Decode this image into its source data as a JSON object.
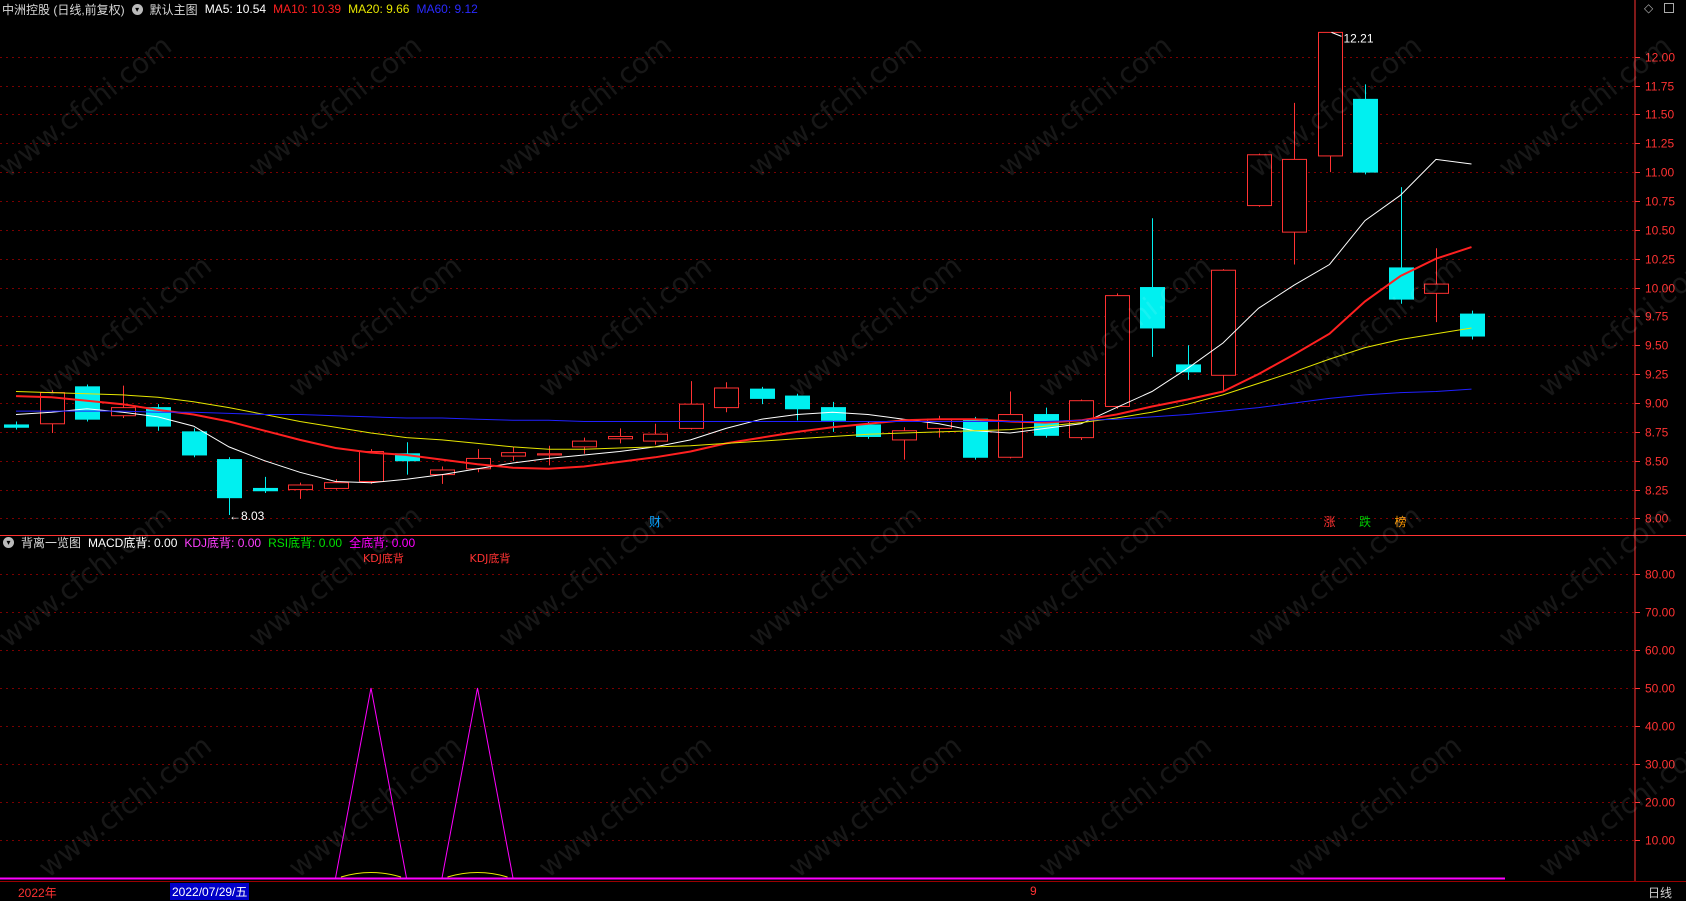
{
  "main_header": {
    "stock": "中洲控股 (日线,前复权)",
    "panel_name": "默认主图",
    "ma5": "MA5: 10.54",
    "ma10": "MA10: 10.39",
    "ma20": "MA20: 9.66",
    "ma60": "MA60: 9.12"
  },
  "sub_header": {
    "panel_name": "背离一览图",
    "macd": "MACD底背: 0.00",
    "kdj": "KDJ底背: 0.00",
    "rsi": "RSI底背: 0.00",
    "all": "全底背: 0.00"
  },
  "colors": {
    "up": "#ff3232",
    "down": "#00f0f0",
    "ma5": "#ffffff",
    "ma10": "#ff2020",
    "ma20": "#e6e600",
    "ma60": "#2020ff",
    "grid": "#7a0000",
    "axis": "#ff3232",
    "sub_line": "#ff00ff"
  },
  "watermark": "www.cfchi.com",
  "chart_data": [
    {
      "type": "candlestick",
      "title": "默认主图",
      "ylim": [
        7.9,
        12.3
      ],
      "y_ticks": [
        "12.00",
        "11.75",
        "11.50",
        "11.25",
        "11.00",
        "10.75",
        "10.50",
        "10.25",
        "10.00",
        "9.75",
        "9.50",
        "9.25",
        "9.00",
        "8.75",
        "8.50",
        "8.25",
        "8.00"
      ],
      "candles": [
        {
          "o": 8.81,
          "c": 8.79,
          "h": 8.84,
          "l": 8.77
        },
        {
          "o": 8.82,
          "c": 9.09,
          "h": 9.11,
          "l": 8.74
        },
        {
          "o": 9.14,
          "c": 8.86,
          "h": 9.16,
          "l": 8.84
        },
        {
          "o": 8.89,
          "c": 8.96,
          "h": 9.15,
          "l": 8.87
        },
        {
          "o": 8.96,
          "c": 8.8,
          "h": 8.99,
          "l": 8.76
        },
        {
          "o": 8.75,
          "c": 8.55,
          "h": 8.78,
          "l": 8.53
        },
        {
          "o": 8.51,
          "c": 8.18,
          "h": 8.53,
          "l": 8.03
        },
        {
          "o": 8.26,
          "c": 8.24,
          "h": 8.36,
          "l": 8.22
        },
        {
          "o": 8.25,
          "c": 8.29,
          "h": 8.31,
          "l": 8.17
        },
        {
          "o": 8.26,
          "c": 8.31,
          "h": 8.34,
          "l": 8.25
        },
        {
          "o": 8.32,
          "c": 8.58,
          "h": 8.6,
          "l": 8.3
        },
        {
          "o": 8.56,
          "c": 8.5,
          "h": 8.66,
          "l": 8.38
        },
        {
          "o": 8.38,
          "c": 8.42,
          "h": 8.45,
          "l": 8.3
        },
        {
          "o": 8.43,
          "c": 8.52,
          "h": 8.6,
          "l": 8.4
        },
        {
          "o": 8.54,
          "c": 8.57,
          "h": 8.62,
          "l": 8.5
        },
        {
          "o": 8.55,
          "c": 8.56,
          "h": 8.63,
          "l": 8.46
        },
        {
          "o": 8.62,
          "c": 8.67,
          "h": 8.7,
          "l": 8.56
        },
        {
          "o": 8.69,
          "c": 8.71,
          "h": 8.78,
          "l": 8.65
        },
        {
          "o": 8.67,
          "c": 8.73,
          "h": 8.82,
          "l": 8.64
        },
        {
          "o": 8.78,
          "c": 8.99,
          "h": 9.19,
          "l": 8.77
        },
        {
          "o": 8.96,
          "c": 9.13,
          "h": 9.18,
          "l": 8.92
        },
        {
          "o": 9.12,
          "c": 9.04,
          "h": 9.14,
          "l": 8.99
        },
        {
          "o": 9.06,
          "c": 8.95,
          "h": 9.08,
          "l": 8.85
        },
        {
          "o": 8.96,
          "c": 8.85,
          "h": 9.01,
          "l": 8.75
        },
        {
          "o": 8.81,
          "c": 8.71,
          "h": 8.84,
          "l": 8.69
        },
        {
          "o": 8.68,
          "c": 8.76,
          "h": 8.79,
          "l": 8.51
        },
        {
          "o": 8.78,
          "c": 8.86,
          "h": 8.89,
          "l": 8.7
        },
        {
          "o": 8.86,
          "c": 8.53,
          "h": 8.88,
          "l": 8.51
        },
        {
          "o": 8.53,
          "c": 8.9,
          "h": 9.1,
          "l": 8.52
        },
        {
          "o": 8.9,
          "c": 8.72,
          "h": 8.96,
          "l": 8.7
        },
        {
          "o": 8.7,
          "c": 9.02,
          "h": 9.03,
          "l": 8.68
        },
        {
          "o": 8.97,
          "c": 9.93,
          "h": 9.95,
          "l": 8.95
        },
        {
          "o": 10.0,
          "c": 9.65,
          "h": 10.6,
          "l": 9.4
        },
        {
          "o": 9.33,
          "c": 9.27,
          "h": 9.5,
          "l": 9.2
        },
        {
          "o": 9.24,
          "c": 10.15,
          "h": 10.16,
          "l": 9.1
        },
        {
          "o": 10.71,
          "c": 11.15,
          "h": 11.16,
          "l": 10.7
        },
        {
          "o": 10.48,
          "c": 11.11,
          "h": 11.6,
          "l": 10.2
        },
        {
          "o": 11.14,
          "c": 12.21,
          "h": 12.21,
          "l": 11.0
        },
        {
          "o": 11.63,
          "c": 11.0,
          "h": 11.76,
          "l": 10.98
        },
        {
          "o": 10.17,
          "c": 9.9,
          "h": 10.87,
          "l": 9.86
        },
        {
          "o": 9.95,
          "c": 10.03,
          "h": 10.34,
          "l": 9.7
        },
        {
          "o": 9.77,
          "c": 9.58,
          "h": 9.8,
          "l": 9.55
        }
      ],
      "series": [
        {
          "name": "MA5",
          "values": [
            8.9,
            8.92,
            8.95,
            8.92,
            8.88,
            8.8,
            8.62,
            8.5,
            8.4,
            8.32,
            8.31,
            8.34,
            8.38,
            8.43,
            8.48,
            8.52,
            8.55,
            8.58,
            8.62,
            8.68,
            8.78,
            8.86,
            8.9,
            8.92,
            8.9,
            8.86,
            8.82,
            8.76,
            8.74,
            8.78,
            8.82,
            8.96,
            9.1,
            9.3,
            9.52,
            9.82,
            10.02,
            10.2,
            10.58,
            10.8,
            11.11,
            11.07
          ]
        },
        {
          "name": "MA10",
          "values": [
            9.06,
            9.05,
            9.02,
            8.99,
            8.94,
            8.9,
            8.84,
            8.76,
            8.68,
            8.61,
            8.57,
            8.55,
            8.51,
            8.47,
            8.44,
            8.43,
            8.45,
            8.49,
            8.53,
            8.58,
            8.65,
            8.7,
            8.75,
            8.79,
            8.82,
            8.85,
            8.86,
            8.86,
            8.84,
            8.83,
            8.85,
            8.9,
            8.97,
            9.03,
            9.1,
            9.25,
            9.42,
            9.6,
            9.88,
            10.1,
            10.25,
            10.35
          ]
        },
        {
          "name": "MA20",
          "values": [
            9.1,
            9.09,
            9.08,
            9.07,
            9.05,
            9.01,
            8.96,
            8.9,
            8.84,
            8.79,
            8.74,
            8.7,
            8.68,
            8.65,
            8.62,
            8.6,
            8.6,
            8.61,
            8.62,
            8.63,
            8.65,
            8.67,
            8.69,
            8.71,
            8.73,
            8.74,
            8.75,
            8.76,
            8.77,
            8.8,
            8.83,
            8.87,
            8.92,
            8.99,
            9.07,
            9.17,
            9.27,
            9.38,
            9.48,
            9.55,
            9.6,
            9.65
          ]
        },
        {
          "name": "MA60",
          "values": [
            8.93,
            8.93,
            8.93,
            8.93,
            8.92,
            8.92,
            8.91,
            8.9,
            8.9,
            8.89,
            8.88,
            8.87,
            8.87,
            8.86,
            8.85,
            8.85,
            8.84,
            8.84,
            8.84,
            8.84,
            8.84,
            8.84,
            8.84,
            8.84,
            8.84,
            8.84,
            8.84,
            8.84,
            8.84,
            8.84,
            8.85,
            8.86,
            8.88,
            8.9,
            8.93,
            8.96,
            9.0,
            9.04,
            9.07,
            9.09,
            9.1,
            9.12
          ]
        }
      ],
      "annotations": {
        "high_label": "12.21",
        "low_label": "8.03"
      },
      "event_markers": [
        {
          "index": 18,
          "text": "财",
          "color": "#00a0ff"
        },
        {
          "index": 37,
          "text": "涨",
          "color": "#ff3232"
        },
        {
          "index": 38,
          "text": "跌",
          "color": "#00c800"
        },
        {
          "index": 39,
          "text": "榜",
          "color": "#ff9900"
        }
      ]
    },
    {
      "type": "line",
      "title": "背离一览图",
      "ylim": [
        0,
        85
      ],
      "y_ticks": [
        "80.00",
        "70.00",
        "60.00",
        "50.00",
        "40.00",
        "30.00",
        "20.00",
        "10.00"
      ],
      "series": [
        {
          "name": "KDJ底背",
          "values": [
            0,
            0,
            0,
            0,
            0,
            0,
            0,
            0,
            0,
            0,
            50,
            0,
            0,
            50,
            0,
            0,
            0,
            0,
            0,
            0,
            0,
            0,
            0,
            0,
            0,
            0,
            0,
            0,
            0,
            0,
            0,
            0,
            0,
            0,
            0,
            0,
            0,
            0,
            0,
            0,
            0,
            0
          ]
        }
      ],
      "top_labels": [
        {
          "index": 10,
          "text": "KDJ底背"
        },
        {
          "index": 13,
          "text": "KDJ底背"
        }
      ]
    }
  ],
  "x_axis": {
    "year_label": "2022年",
    "cursor_date": "2022/07/29/五",
    "month_label": "9"
  },
  "period_label": "日线"
}
